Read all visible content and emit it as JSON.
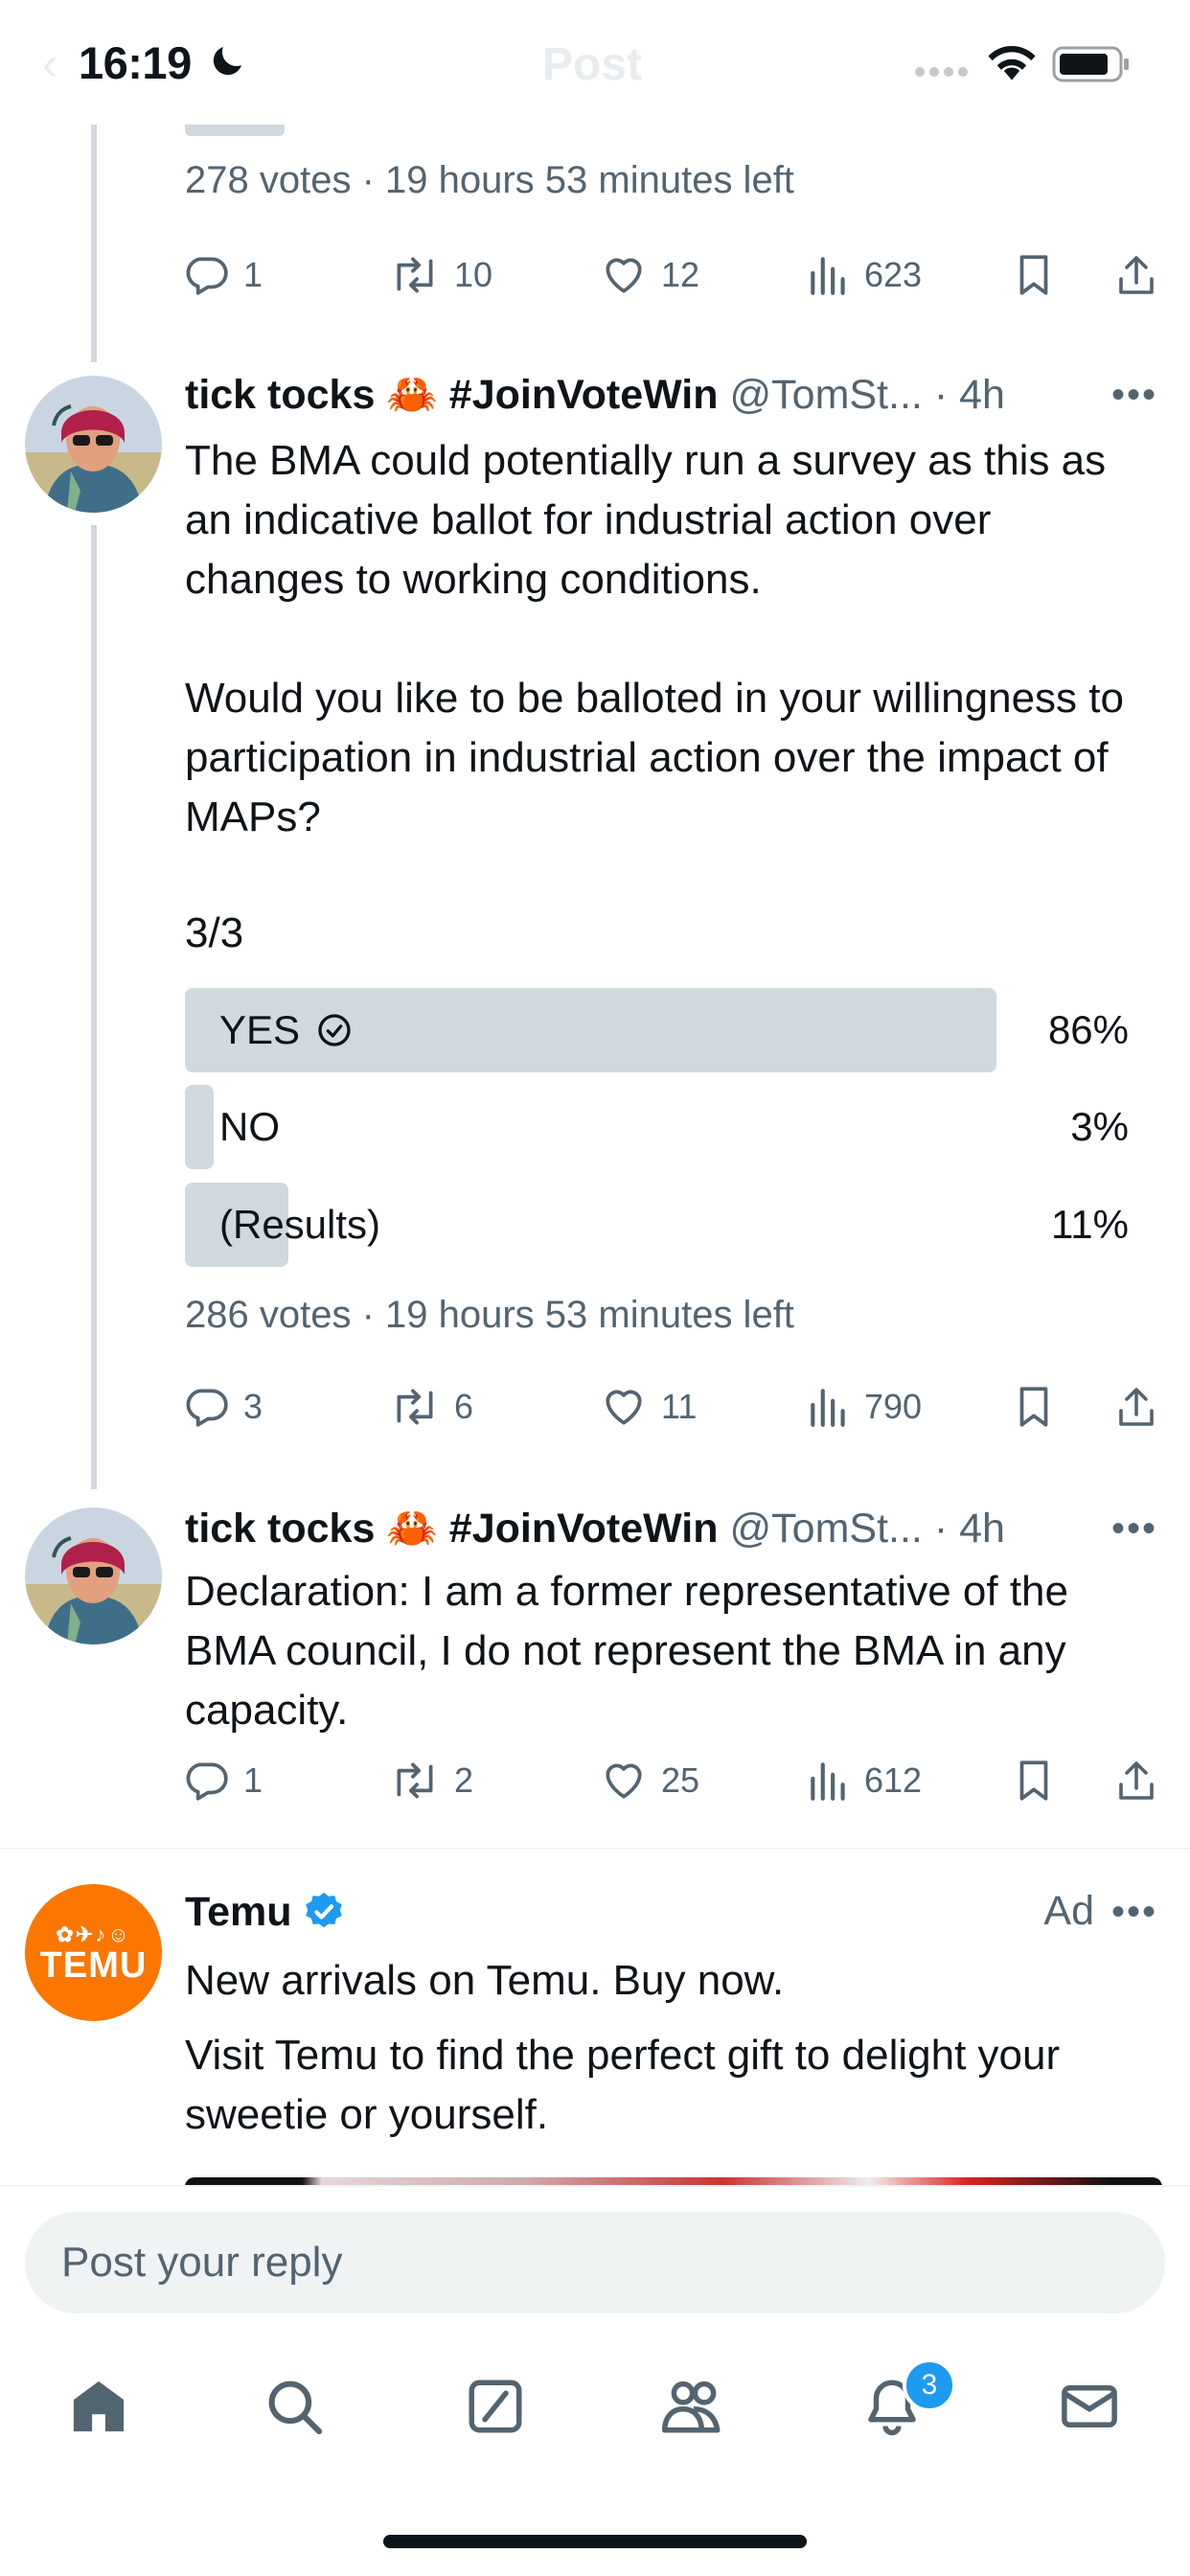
{
  "status_bar": {
    "time": "16:19",
    "ghost_title": "Post"
  },
  "poll1": {
    "meta": "278 votes · 19 hours 53 minutes left"
  },
  "actions1": {
    "replies": "1",
    "reposts": "10",
    "likes": "12",
    "views": "623"
  },
  "tweet2": {
    "name": "tick tocks 🦀 #JoinVoteWin",
    "handle": "@TomSt... · 4h",
    "text_p1": "The BMA could potentially run a survey as this as an indicative ballot for industrial action over changes to working conditions.",
    "text_p2": "Would you like to be balloted in your willingness to participation in industrial action over the impact of MAPs?",
    "text_p3": "3/3",
    "poll": {
      "options": [
        {
          "label": "YES",
          "pct": "86%",
          "value": 86,
          "selected": true
        },
        {
          "label": "NO",
          "pct": "3%",
          "value": 3,
          "selected": false
        },
        {
          "label": "(Results)",
          "pct": "11%",
          "value": 11,
          "selected": false
        }
      ],
      "meta": "286 votes · 19 hours 53 minutes left"
    },
    "actions": {
      "replies": "3",
      "reposts": "6",
      "likes": "11",
      "views": "790"
    }
  },
  "tweet3": {
    "name": "tick tocks 🦀 #JoinVoteWin",
    "handle": "@TomSt... · 4h",
    "text": "Declaration: I am a former representative of the BMA council, I do not represent the BMA in any capacity.",
    "actions": {
      "replies": "1",
      "reposts": "2",
      "likes": "25",
      "views": "612"
    }
  },
  "ad": {
    "name": "Temu",
    "label": "Ad",
    "logo_text": "TEMU",
    "headline": "New arrivals on Temu. Buy now.",
    "text": "Visit Temu to find the perfect gift to delight your sweetie or yourself.",
    "logo_color": "#fb7701"
  },
  "reply": {
    "placeholder": "Post your reply"
  },
  "nav": {
    "notifications_badge": "3"
  },
  "colors": {
    "accent": "#1d9bf0",
    "poll_fill": "#cfd9de",
    "muted": "#536471"
  }
}
